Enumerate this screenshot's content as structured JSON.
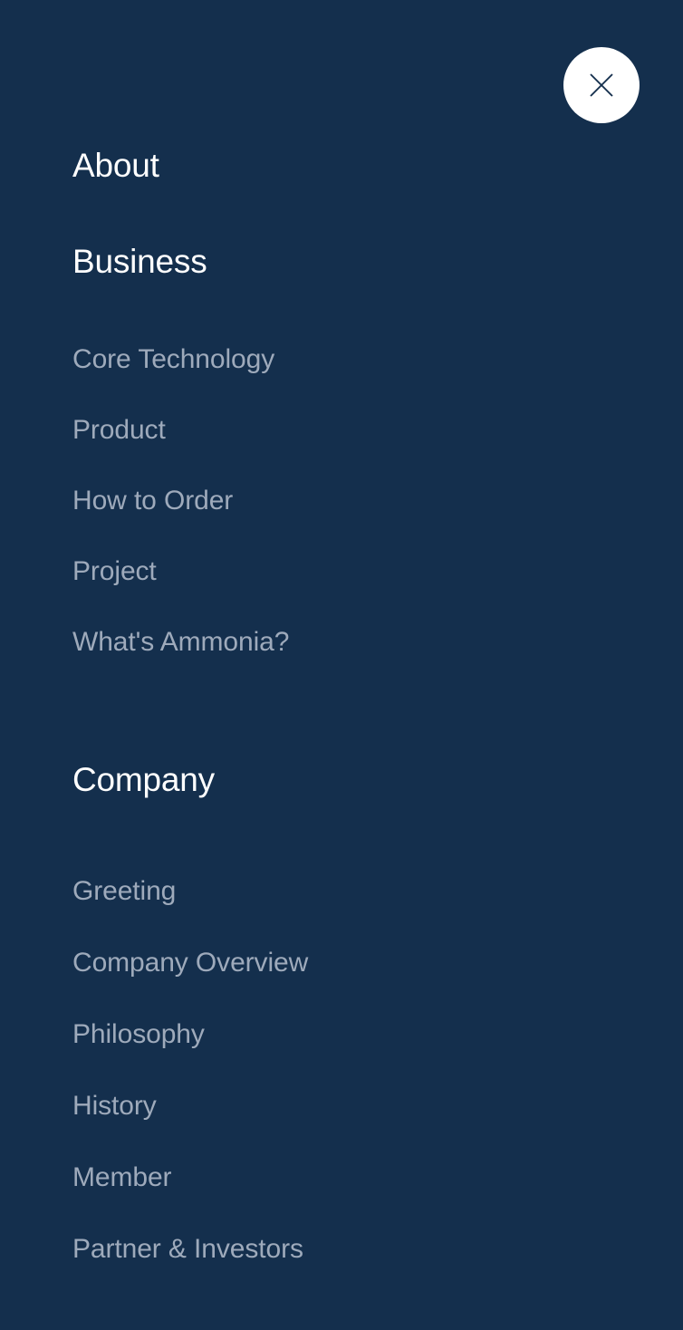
{
  "theme": {
    "background": "#142f4d",
    "heading_color": "#ffffff",
    "sub_item_color": "#9eaabb",
    "close_button_background": "#ffffff",
    "close_icon_color": "#142f4d"
  },
  "close_button": {
    "icon": "close-icon",
    "label": "Close"
  },
  "nav": {
    "sections": [
      {
        "heading": "About",
        "items": []
      },
      {
        "heading": "Business",
        "items": [
          {
            "label": "Core Technology"
          },
          {
            "label": "Product"
          },
          {
            "label": "How to Order"
          },
          {
            "label": "Project"
          },
          {
            "label": "What's Ammonia?"
          }
        ]
      },
      {
        "heading": "Company",
        "items": [
          {
            "label": "Greeting"
          },
          {
            "label": "Company Overview"
          },
          {
            "label": "Philosophy"
          },
          {
            "label": "History"
          },
          {
            "label": "Member"
          },
          {
            "label": "Partner & Investors"
          }
        ]
      }
    ]
  }
}
